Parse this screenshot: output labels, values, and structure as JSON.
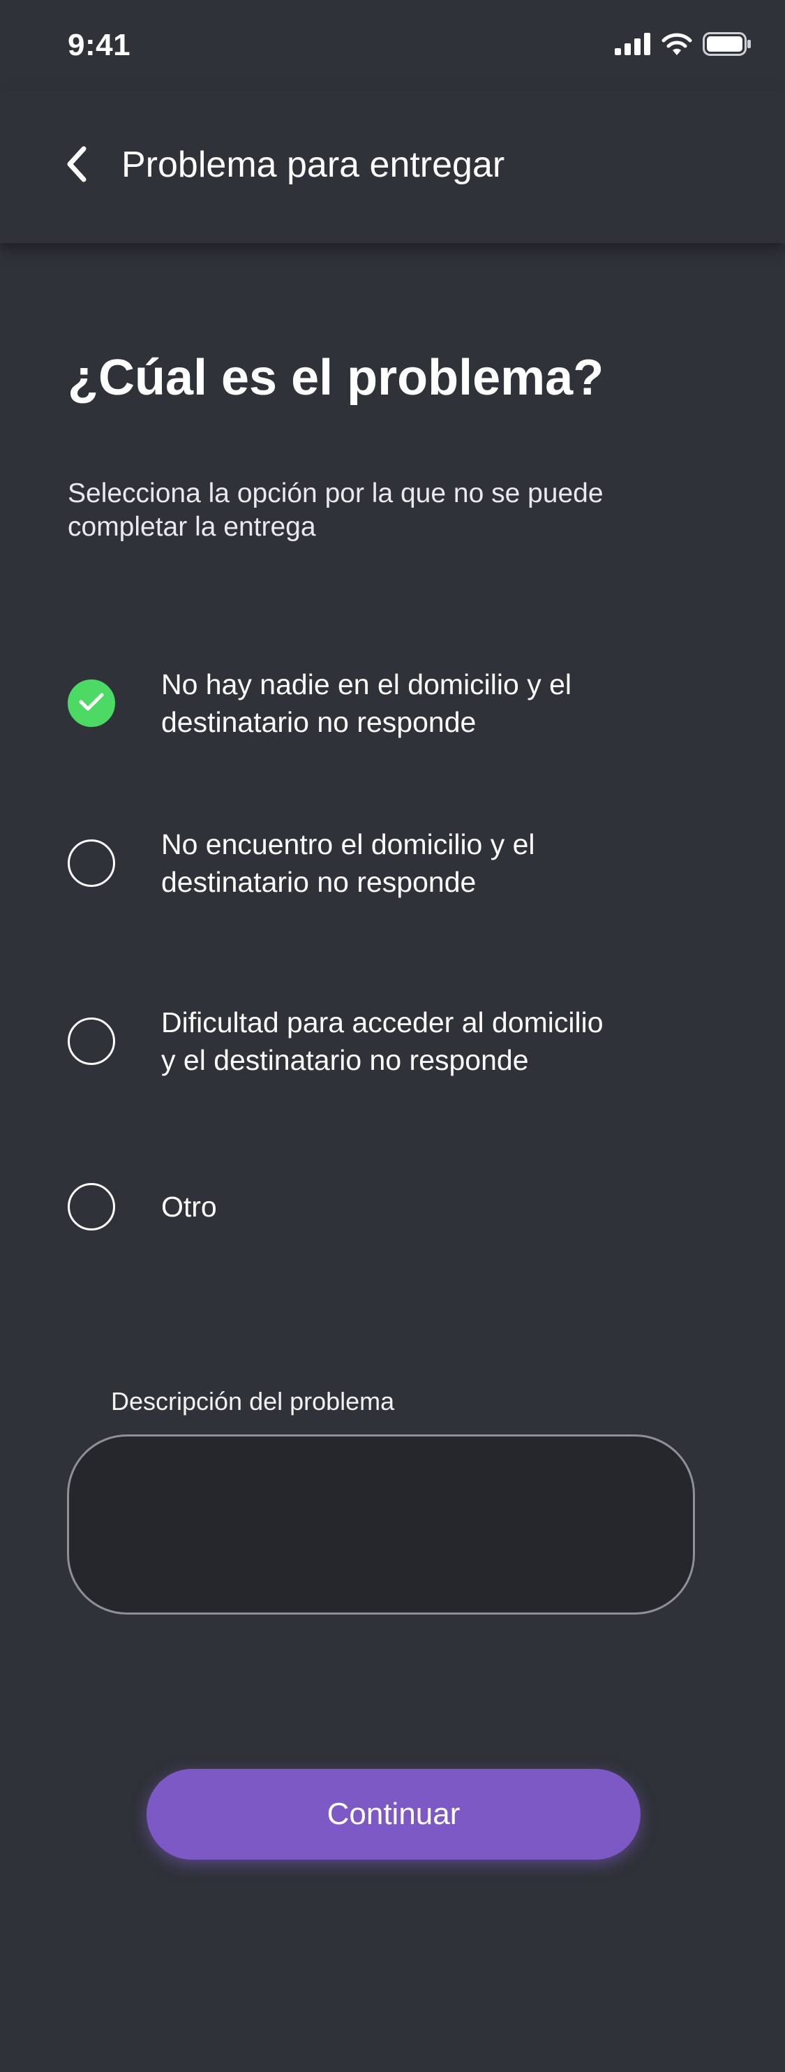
{
  "status_bar": {
    "time": "9:41",
    "icons": [
      "cellular-signal-icon",
      "wifi-icon",
      "battery-icon"
    ]
  },
  "header": {
    "back_icon": "chevron-left-icon",
    "title": "Problema para entregar"
  },
  "content": {
    "heading": "¿Cúal es el problema?",
    "subtitle": "Selecciona la opción por la que no se puede completar la entrega"
  },
  "options": [
    {
      "label": "No hay nadie en el domicilio y el destinatario no responde",
      "selected": true
    },
    {
      "label": "No encuentro el domicilio y el destinatario no responde",
      "selected": false
    },
    {
      "label": "Dificultad para acceder al domicilio y el destinatario no responde",
      "selected": false
    },
    {
      "label": "Otro",
      "selected": false
    }
  ],
  "description": {
    "label": "Descripción del problema",
    "value": "",
    "placeholder": ""
  },
  "actions": {
    "continue_label": "Continuar"
  },
  "colors": {
    "background": "#2f3239",
    "selected": "#4cd964",
    "primary_button": "#7d59c5",
    "field_background": "#25272c",
    "field_border": "#8e9096"
  }
}
